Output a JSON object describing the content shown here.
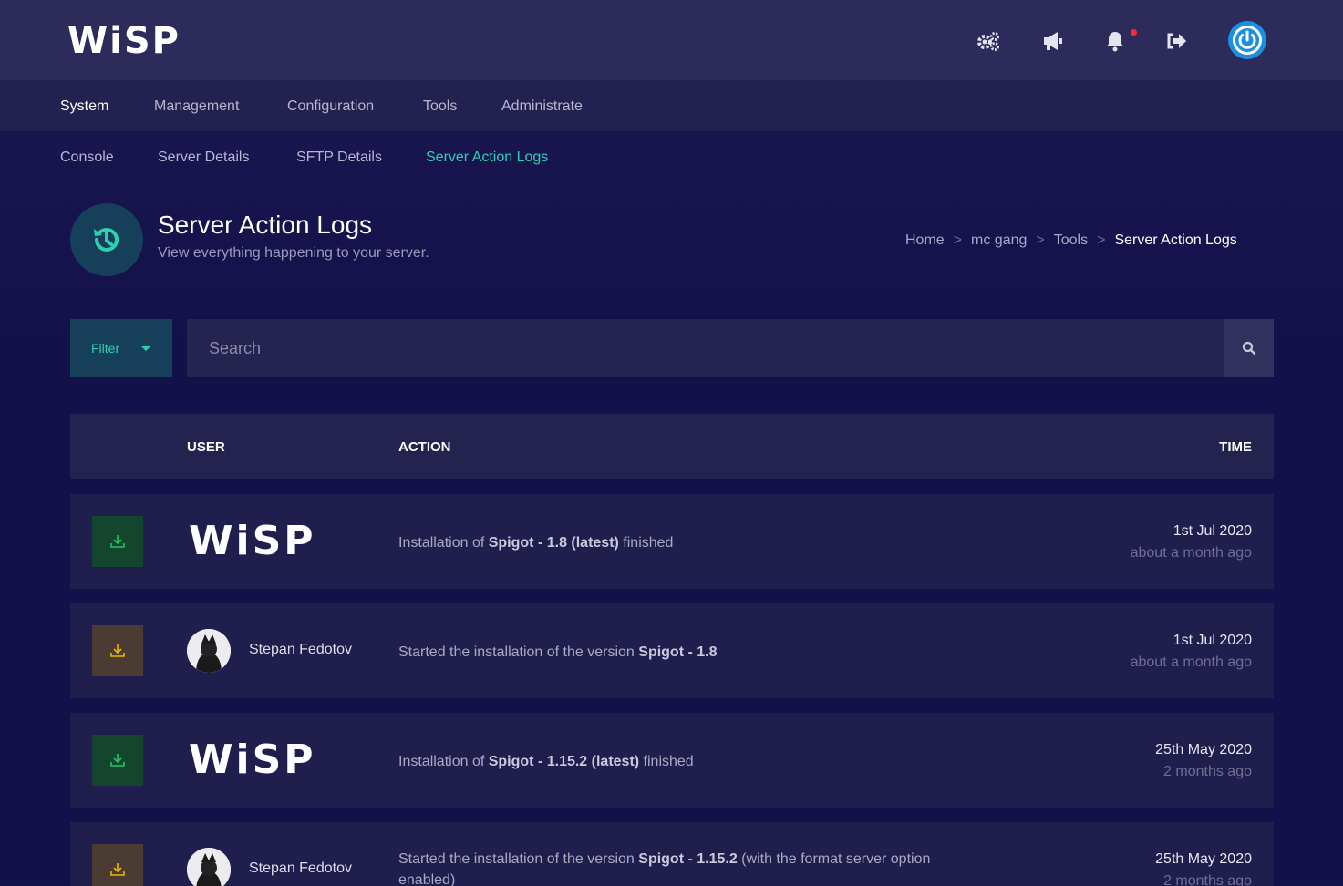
{
  "app": {
    "logo_text": "WiSP"
  },
  "top_icons": [
    "gears-icon",
    "megaphone-icon",
    "bell-icon",
    "sign-out-icon",
    "power-icon"
  ],
  "nav_primary": [
    {
      "label": "System",
      "active": true
    },
    {
      "label": "Management",
      "active": false
    },
    {
      "label": "Configuration",
      "active": false
    },
    {
      "label": "Tools",
      "active": false
    },
    {
      "label": "Administrate",
      "active": false
    }
  ],
  "nav_secondary": [
    {
      "label": "Console",
      "active": false
    },
    {
      "label": "Server Details",
      "active": false
    },
    {
      "label": "SFTP Details",
      "active": false
    },
    {
      "label": "Server Action Logs",
      "active": true
    }
  ],
  "page": {
    "title": "Server Action Logs",
    "subtitle": "View everything happening to your server.",
    "icon": "history-icon"
  },
  "breadcrumb": {
    "items": [
      "Home",
      "mc gang",
      "Tools",
      "Server Action Logs"
    ],
    "separator": ">"
  },
  "filter": {
    "label": "Filter"
  },
  "search": {
    "placeholder": "Search"
  },
  "table": {
    "headers": {
      "user": "USER",
      "action": "ACTION",
      "time": "TIME"
    },
    "rows": [
      {
        "badge_color": "#14452f",
        "user": "WiSP",
        "action_parts": [
          "Installation of ",
          "Spigot - 1.8 (latest)",
          " finished"
        ],
        "date": "1st Jul 2020",
        "ago": "about a month ago"
      },
      {
        "badge_color": "#4a3b33",
        "user": "Stepan Fedotov",
        "action_parts": [
          "Started the installation of the version ",
          "Spigot - 1.8",
          ""
        ],
        "date": "1st Jul 2020",
        "ago": "about a month ago"
      },
      {
        "badge_color": "#14452f",
        "user": "WiSP",
        "action_parts": [
          "Installation of ",
          "Spigot - 1.15.2 (latest)",
          " finished"
        ],
        "date": "25th May 2020",
        "ago": "2 months ago"
      },
      {
        "badge_color": "#4a3b33",
        "user": "Stepan Fedotov",
        "action_parts": [
          "Started the installation of the version ",
          "Spigot - 1.15.2",
          " (with the format server option enabled)"
        ],
        "date": "25th May 2020",
        "ago": "2 months ago"
      }
    ]
  },
  "colors": {
    "accent": "#2fd0b0",
    "power": "#1d8fe0",
    "notification": "#ff2a2a"
  }
}
